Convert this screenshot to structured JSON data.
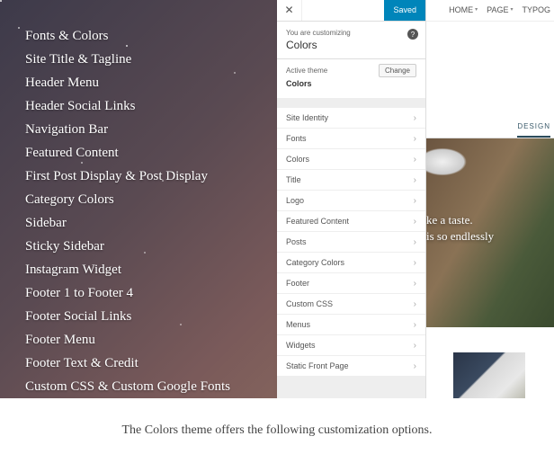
{
  "caption": "The Colors theme offers the following customization options.",
  "feature_list": [
    "Fonts & Colors",
    "Site Title & Tagline",
    "Header Menu",
    "Header Social Links",
    "Navigation Bar",
    "Featured Content",
    "First Post Display & Post Display",
    "Category Colors",
    "Sidebar",
    "Sticky Sidebar",
    "Instagram Widget",
    "Footer 1 to Footer 4",
    "Footer Social Links",
    "Footer Menu",
    "Footer Text & Credit",
    "Custom CSS & Custom Google Fonts"
  ],
  "customizer": {
    "saved": "Saved",
    "heading_sub": "You are customizing",
    "heading_title": "Colors",
    "active_theme_label": "Active theme",
    "active_theme_value": "Colors",
    "change": "Change",
    "sections": [
      "Site Identity",
      "Fonts",
      "Colors",
      "Title",
      "Logo",
      "Featured Content",
      "Posts",
      "Category Colors",
      "Footer",
      "Custom CSS",
      "Menus",
      "Widgets",
      "Static Front Page"
    ]
  },
  "preview": {
    "nav": [
      "HOME",
      "PAGE",
      "TYPOG"
    ],
    "tab": "DESIGN",
    "hero_line1": "ke a taste.",
    "hero_line2": "is so endlessly"
  }
}
